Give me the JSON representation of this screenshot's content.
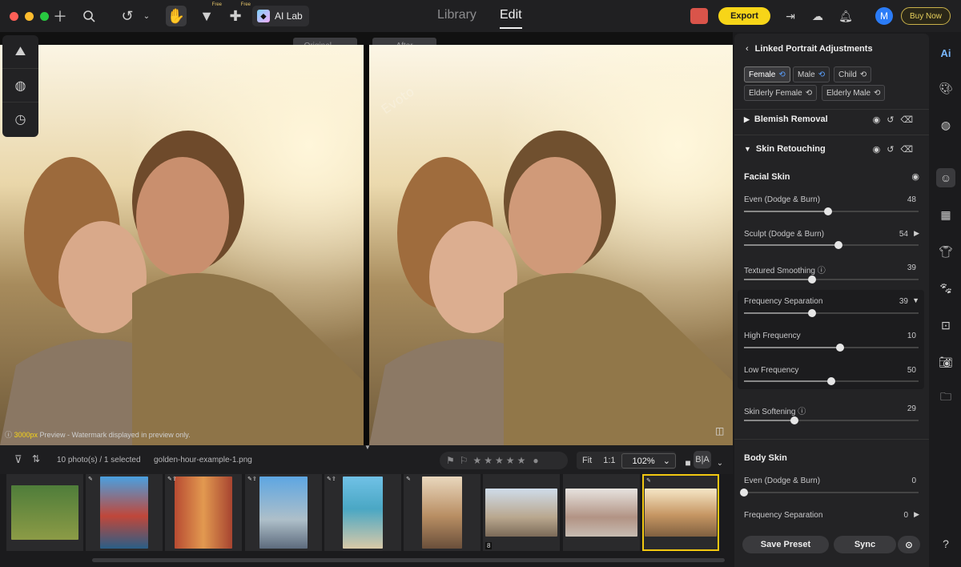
{
  "topbar": {
    "ailab": "AI Lab",
    "free_tag_1": "Free",
    "free_tag_2": "Free",
    "nav_library": "Library",
    "nav_edit": "Edit",
    "export": "Export",
    "avatar_initial": "M",
    "buy_now": "Buy Now"
  },
  "canvas": {
    "original_label": "Original",
    "after_label": "After",
    "watermark_highlight": "3000px",
    "watermark_text": " Preview - Watermark displayed in preview only.",
    "watermark_overlay": "Evoto"
  },
  "filmstrip": {
    "count_text": "10 photo(s) / 1 selected",
    "filename": "golden-hour-example-1.png",
    "zoom_fit": "Fit",
    "zoom_1to1": "1:1",
    "zoom_pct": "102%",
    "stack_count": "8",
    "rating_stars": "★★★★★"
  },
  "panel": {
    "title": "Linked Portrait Adjustments",
    "chips": [
      "Female",
      "Male",
      "Child",
      "Elderly Female",
      "Elderly Male"
    ],
    "blemish": "Blemish Removal",
    "skin": "Skin Retouching",
    "facial_skin": "Facial Skin",
    "body_skin": "Body Skin",
    "sliders": [
      {
        "label": "Even (Dodge & Burn)",
        "value": "48",
        "pct": 0.48
      },
      {
        "label": "Sculpt (Dodge & Burn)",
        "value": "54",
        "pct": 0.54
      },
      {
        "label": "Textured Smoothing",
        "value": "39",
        "pct": 0.39
      },
      {
        "label": "Frequency Separation",
        "value": "39",
        "pct": 0.39
      },
      {
        "label": "High Frequency",
        "value": "10",
        "pct": 0.55
      },
      {
        "label": "Low Frequency",
        "value": "50",
        "pct": 0.5
      },
      {
        "label": "Skin Softening",
        "value": "29",
        "pct": 0.29
      },
      {
        "label": "Even (Dodge & Burn)",
        "value": "0",
        "pct": 0.0
      },
      {
        "label": "Frequency Separation",
        "value": "0",
        "pct": 0.0
      }
    ],
    "save_preset": "Save Preset",
    "sync": "Sync"
  },
  "strip": {
    "ai_label": "Ai",
    "help": "?"
  },
  "colors": {
    "accent_yellow": "#f7d518",
    "selected_border": "#f2c811",
    "avatar_blue": "#2b7cf7"
  }
}
